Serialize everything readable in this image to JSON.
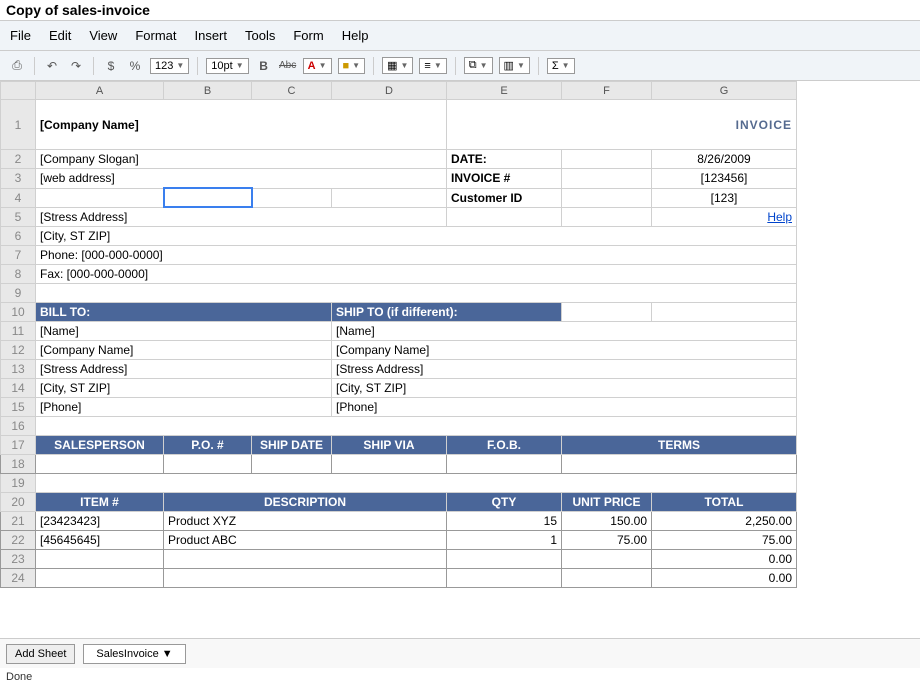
{
  "window": {
    "title": "Copy of sales-invoice"
  },
  "menu": [
    "File",
    "Edit",
    "View",
    "Format",
    "Insert",
    "Tools",
    "Form",
    "Help"
  ],
  "toolbar": {
    "currency": "$",
    "percent": "%",
    "num_format": "123",
    "font_size": "10pt",
    "bold": "B",
    "strike": "Abc",
    "fontcolor": "A",
    "bgcolor": "■",
    "sigma": "Σ"
  },
  "columns": [
    "A",
    "B",
    "C",
    "D",
    "E",
    "F",
    "G"
  ],
  "rows": [
    "1",
    "2",
    "3",
    "4",
    "5",
    "6",
    "7",
    "8",
    "9",
    "10",
    "11",
    "12",
    "13",
    "14",
    "15",
    "16",
    "17",
    "18",
    "19",
    "20",
    "21",
    "22",
    "23",
    "24"
  ],
  "invoice": {
    "title": "INVOICE",
    "company_name": "[Company Name]",
    "slogan": "[Company Slogan]",
    "web": "[web address]",
    "address": "[Stress Address]",
    "city": "[City, ST ZIP]",
    "phone": "Phone: [000-000-0000]",
    "fax": "Fax: [000-000-0000]",
    "meta": {
      "date_label": "DATE:",
      "date": "8/26/2009",
      "invnum_label": "INVOICE #",
      "invnum": "[123456]",
      "custid_label": "Customer ID",
      "custid": "[123]"
    },
    "help_link": "Help",
    "billto_hdr": "BILL TO:",
    "shipto_hdr": "SHIP TO (if different):",
    "bill": {
      "name": "[Name]",
      "company": "[Company Name]",
      "addr": "[Stress Address]",
      "city": "[City, ST ZIP]",
      "phone": "[Phone]"
    },
    "ship": {
      "name": "[Name]",
      "company": "[Company Name]",
      "addr": "[Stress Address]",
      "city": "[City, ST ZIP]",
      "phone": "[Phone]"
    },
    "sales_hdr": {
      "sp": "SALESPERSON",
      "po": "P.O. #",
      "shipdate": "SHIP DATE",
      "shipvia": "SHIP VIA",
      "fob": "F.O.B.",
      "terms": "TERMS"
    },
    "item_hdr": {
      "item": "ITEM #",
      "desc": "DESCRIPTION",
      "qty": "QTY",
      "unit": "UNIT PRICE",
      "total": "TOTAL"
    },
    "lines": [
      {
        "item": "[23423423]",
        "desc": "Product XYZ",
        "qty": "15",
        "unit": "150.00",
        "total": "2,250.00"
      },
      {
        "item": "[45645645]",
        "desc": "Product ABC",
        "qty": "1",
        "unit": "75.00",
        "total": "75.00"
      },
      {
        "item": "",
        "desc": "",
        "qty": "",
        "unit": "",
        "total": "0.00"
      },
      {
        "item": "",
        "desc": "",
        "qty": "",
        "unit": "",
        "total": "0.00"
      }
    ]
  },
  "tabs": {
    "add": "Add Sheet",
    "sheet1": "SalesInvoice ▼"
  },
  "status": "Done"
}
